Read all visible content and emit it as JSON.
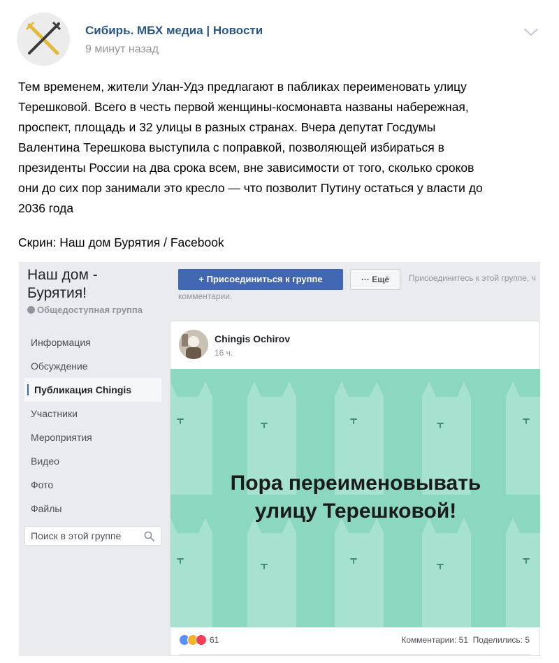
{
  "post": {
    "author": "Сибирь. МБХ медиа | Новости",
    "time": "9 минут назад",
    "text": "Тем временем, жители Улан-Удэ предлагают в пабликах переименовать улицу\nТерешковой. Всего в честь первой женщины-космонавта названы набережная,\nпроспект, площадь и 32 улицы в разных странах. Вчера депутат Госдумы\nВалентина Терешкова выступила с поправкой, позволяющей избираться в\nпрезиденты России на два срока всем, вне зависимости от того, сколько сроков\nони до сих пор занимали это кресло — что позволит Путину остаться у власти до\n2036 года",
    "caption": "Скрин: Наш дом Бурятия / Facebook",
    "accent_color": "#2a5885"
  },
  "fb": {
    "group_name": "Наш дом -\nБурятия!",
    "group_type": "Общедоступная группа",
    "nav": [
      {
        "label": "Информация",
        "active": false
      },
      {
        "label": "Обсуждение",
        "active": false
      },
      {
        "label": "Публикация Chingis",
        "active": true
      },
      {
        "label": "Участники",
        "active": false
      },
      {
        "label": "Мероприятия",
        "active": false
      },
      {
        "label": "Видео",
        "active": false
      },
      {
        "label": "Фото",
        "active": false
      },
      {
        "label": "Файлы",
        "active": false
      }
    ],
    "search_placeholder": "Поиск в этой группе",
    "join_label": "+ Присоединиться к группе",
    "more_label": "··· Ещё",
    "join_hint": "Присоединитесь к этой группе, ч",
    "join_hint2": "комментарии.",
    "post_author": "Chingis Ochirov",
    "post_time": "16 ч.",
    "image_text": "Пора переименовывать\nулицу Терешковой!",
    "image_bg_color": "#8bd7c0",
    "reactions_count": "61",
    "comments": "Комментарии: 51",
    "shares": "Поделились: 5",
    "brand_color": "#4267b2"
  }
}
